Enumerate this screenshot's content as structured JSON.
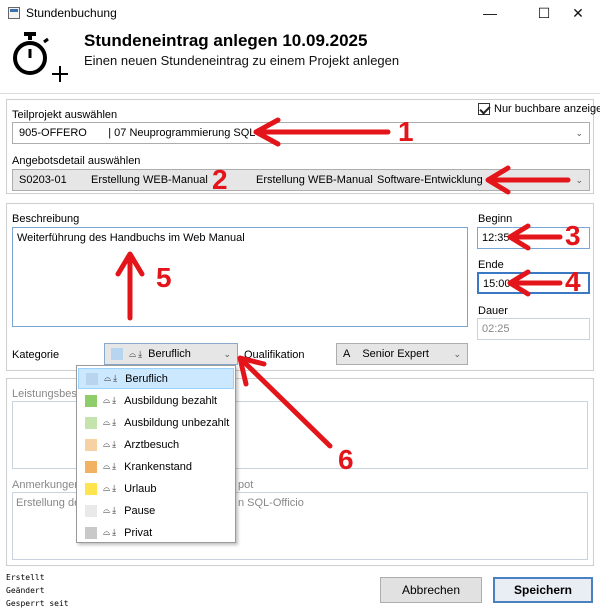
{
  "window": {
    "title": "Stundenbuchung",
    "minimize": "—",
    "maximize": "☐",
    "close": "✕"
  },
  "header": {
    "title": "Stundeneintrag anlegen 10.09.2025",
    "subtitle": "Einen neuen Stundeneintrag zu einem Projekt anlegen"
  },
  "project": {
    "teilprojekt_label": "Teilprojekt auswählen",
    "nur_buchbare_label": "Nur buchbare anzeigen",
    "teilprojekt_value": "905-OFFERO       | 07 Neuprogrammierung SQL",
    "angebotsdetail_label": "Angebotsdetail auswählen",
    "angebotsdetail_code": "S0203-01",
    "angebotsdetail_name1": "Erstellung WEB-Manual",
    "angebotsdetail_name2": "Erstellung WEB-Manual",
    "angebotsdetail_area": "Software-Entwicklung"
  },
  "entry": {
    "beschreibung_label": "Beschreibung",
    "beschreibung_value": "Weiterführung des Handbuchs im Web Manual",
    "beginn_label": "Beginn",
    "beginn_value": "12:35",
    "ende_label": "Ende",
    "ende_value": "15:00",
    "dauer_label": "Dauer",
    "dauer_value": "02:25",
    "kategorie_label": "Kategorie",
    "kategorie_value": "Beruflich",
    "qualifikation_label": "Qualifikation",
    "qualifikation_code": "A",
    "qualifikation_value": "Senior Expert"
  },
  "lower": {
    "leistung_label": "Leistungsbesch",
    "anmerkungen_label_left": "Anmerkungen z",
    "anmerkungen_label_right": "pot",
    "anmerkungen_text_left": "Erstellung des",
    "anmerkungen_text_right": "n SQL-Officio"
  },
  "dropdown": {
    "items": [
      {
        "label": "Beruflich",
        "color": "#b8d5f0"
      },
      {
        "label": "Ausbildung bezahlt",
        "color": "#8fcd6a"
      },
      {
        "label": "Ausbildung unbezahlt",
        "color": "#c5e3ad"
      },
      {
        "label": "Arztbesuch",
        "color": "#f6d1a3"
      },
      {
        "label": "Krankenstand",
        "color": "#f2b263"
      },
      {
        "label": "Urlaub",
        "color": "#ffe44e"
      },
      {
        "label": "Pause",
        "color": "#e9e9e9"
      },
      {
        "label": "Privat",
        "color": "#c9c9c9"
      }
    ]
  },
  "footer": {
    "erstellt": "Erstellt",
    "geaendert": "Geändert",
    "gesperrt": "Gesperrt seit",
    "abbrechen": "Abbrechen",
    "speichern": "Speichern"
  },
  "annotations": [
    "1",
    "2",
    "3",
    "4",
    "5",
    "6"
  ],
  "accent_color": "#e3151a"
}
